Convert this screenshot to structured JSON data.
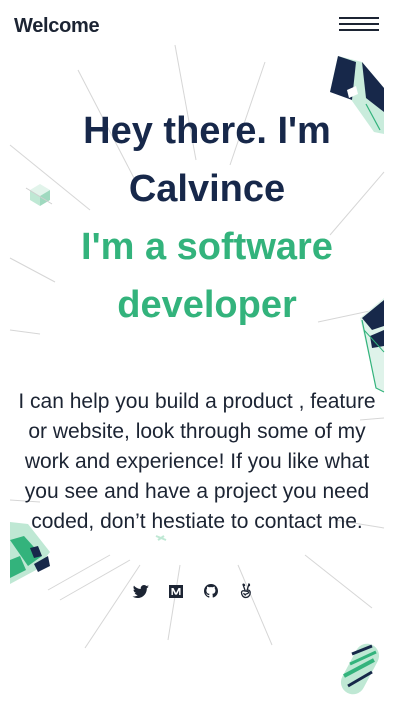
{
  "header": {
    "brand": "Welcome",
    "menu_icon": "hamburger-menu-icon"
  },
  "hero": {
    "intro_line1": "Hey there. I'm",
    "intro_line2": "Calvince",
    "role_line1": "I'm a software",
    "role_line2": "developer"
  },
  "bio": {
    "text": "I can help you build a product , feature or website, look through some of my work and experience! If you like what you see and have a project you need coded, don’t hestiate to contact me."
  },
  "social": [
    {
      "icon": "twitter-icon"
    },
    {
      "icon": "medium-icon"
    },
    {
      "icon": "github-icon"
    },
    {
      "icon": "angellist-icon"
    }
  ],
  "colors": {
    "heading_navy": "#17284a",
    "accent_green": "#33b37c",
    "text_dark": "#1c2433",
    "deco_mint": "#bfe8d4"
  }
}
